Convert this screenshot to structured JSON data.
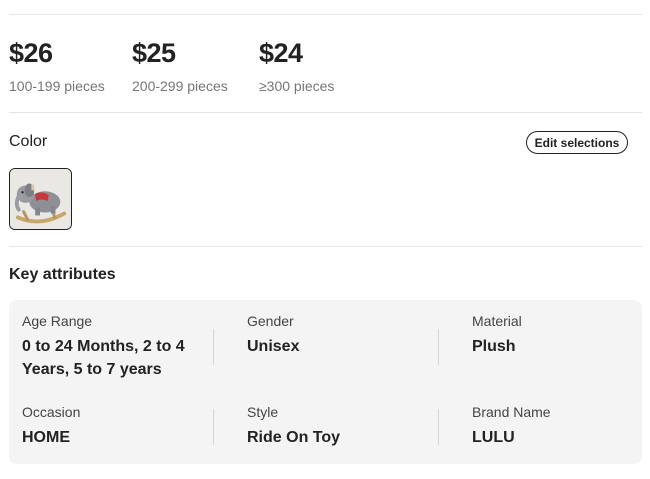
{
  "price_tiers": [
    {
      "price": "$26",
      "range": "100-199 pieces"
    },
    {
      "price": "$25",
      "range": "200-299 pieces"
    },
    {
      "price": "$24",
      "range": "≥300 pieces"
    }
  ],
  "color": {
    "label": "Color",
    "edit_button": "Edit selections",
    "swatch_icon": "plush-elephant-rocking-toy-thumbnail"
  },
  "key_attributes": {
    "title": "Key attributes",
    "items": [
      {
        "name": "Age Range",
        "value": "0 to 24 Months, 2 to 4 Years, 5 to 7 years"
      },
      {
        "name": "Gender",
        "value": "Unisex"
      },
      {
        "name": "Material",
        "value": "Plush"
      },
      {
        "name": "Occasion",
        "value": "HOME"
      },
      {
        "name": "Style",
        "value": "Ride On Toy"
      },
      {
        "name": "Brand Name",
        "value": "LULU"
      }
    ]
  },
  "colors": {
    "text": "#222222",
    "muted": "#767676",
    "panel_bg": "#f4f4f4",
    "divider": "#e5e5e5"
  }
}
